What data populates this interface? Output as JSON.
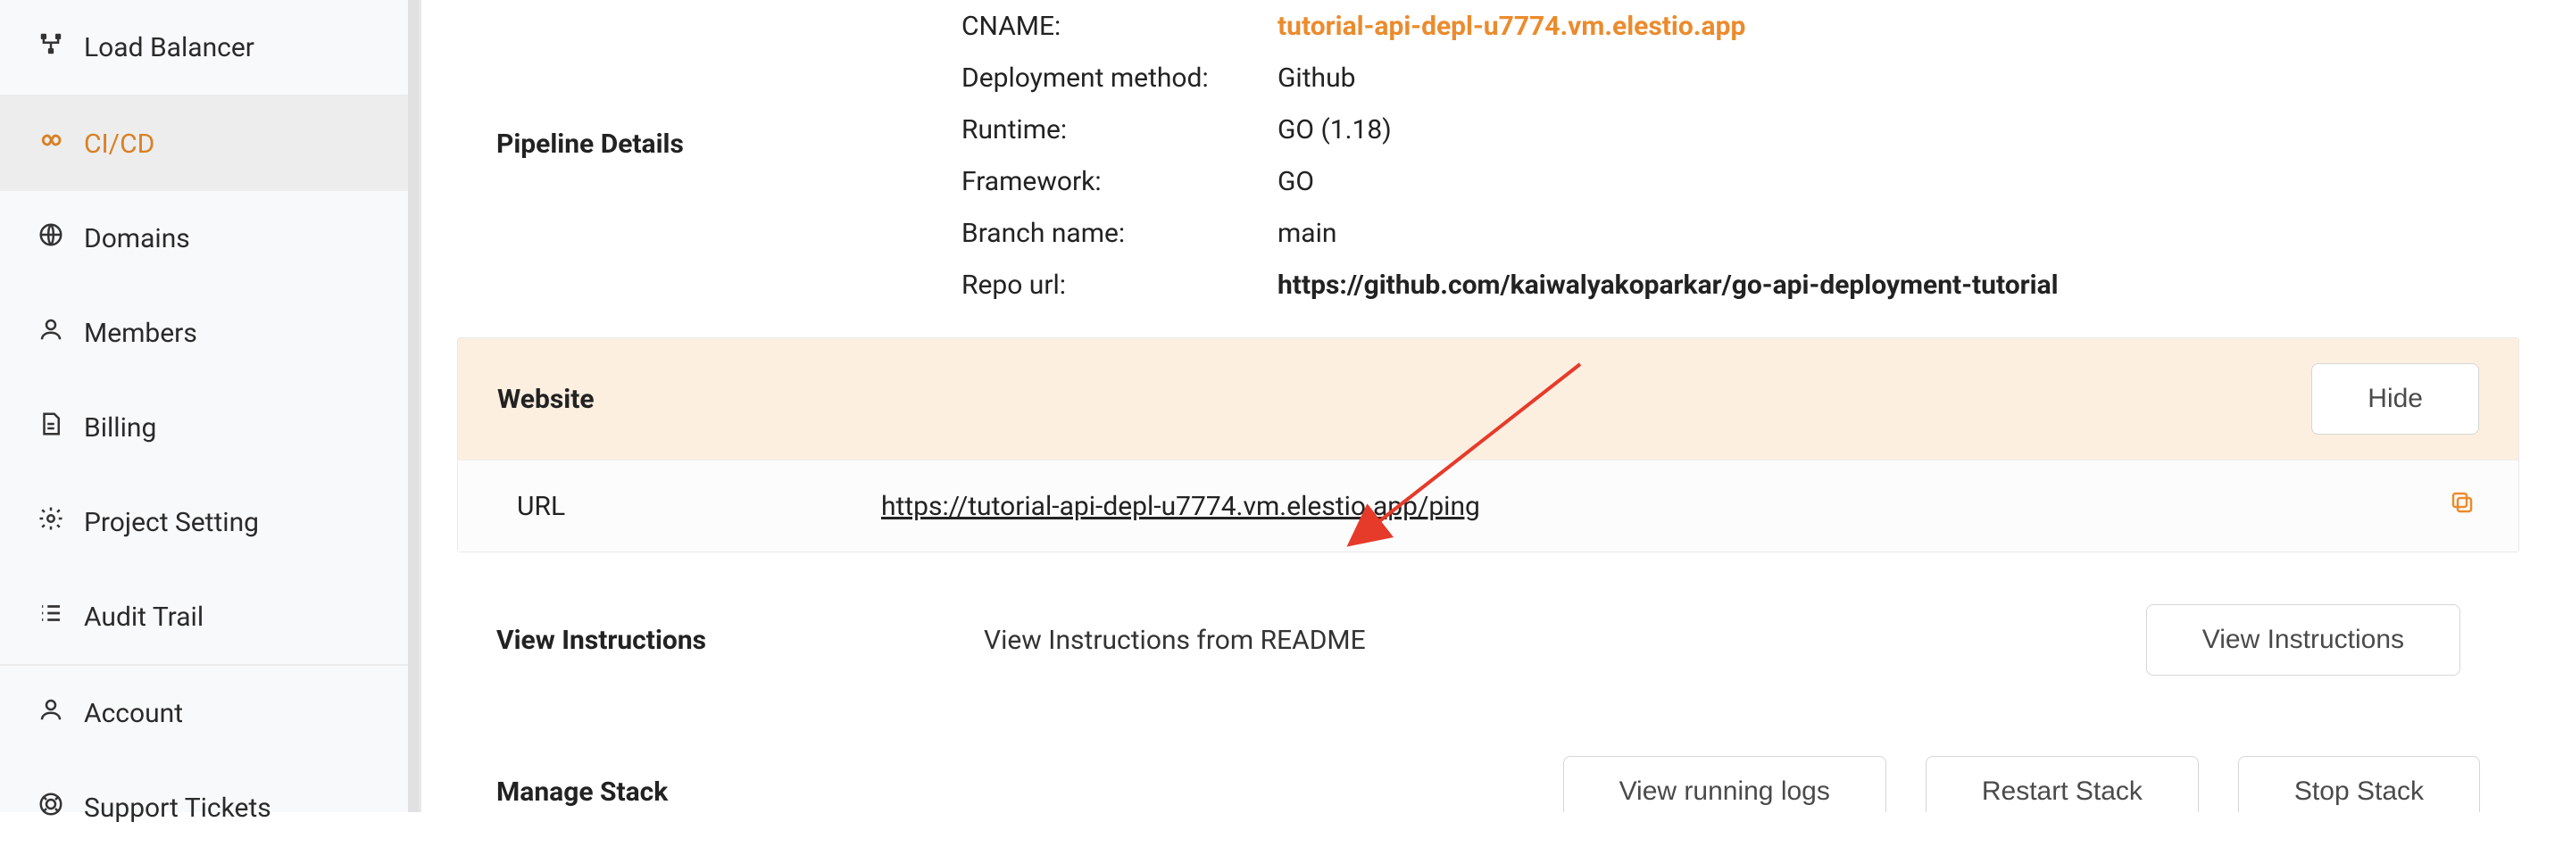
{
  "sidebar": {
    "items": [
      {
        "label": "Load Balancer"
      },
      {
        "label": "CI/CD"
      },
      {
        "label": "Domains"
      },
      {
        "label": "Members"
      },
      {
        "label": "Billing"
      },
      {
        "label": "Project Setting"
      },
      {
        "label": "Audit Trail"
      },
      {
        "label": "Account"
      },
      {
        "label": "Support Tickets"
      }
    ]
  },
  "pipeline": {
    "title": "Pipeline Details",
    "rows": {
      "cname_label": "CNAME:",
      "cname_value": "tutorial-api-depl-u7774.vm.elestio.app",
      "deploy_label": "Deployment method:",
      "deploy_value": "Github",
      "runtime_label": "Runtime:",
      "runtime_value": "GO (1.18)",
      "framework_label": "Framework:",
      "framework_value": "GO",
      "branch_label": "Branch name:",
      "branch_value": "main",
      "repo_label": "Repo url:",
      "repo_value": "https://github.com/kaiwalyakoparkar/go-api-deployment-tutorial"
    }
  },
  "website": {
    "title": "Website",
    "hide_label": "Hide",
    "url_label": "URL",
    "url_value": "https://tutorial-api-depl-u7774.vm.elestio.app/ping"
  },
  "instructions": {
    "title": "View Instructions",
    "desc": "View Instructions from README",
    "btn": "View Instructions"
  },
  "stack": {
    "title": "Manage Stack",
    "logs_btn": "View running logs",
    "restart_btn": "Restart Stack",
    "stop_btn": "Stop Stack"
  }
}
